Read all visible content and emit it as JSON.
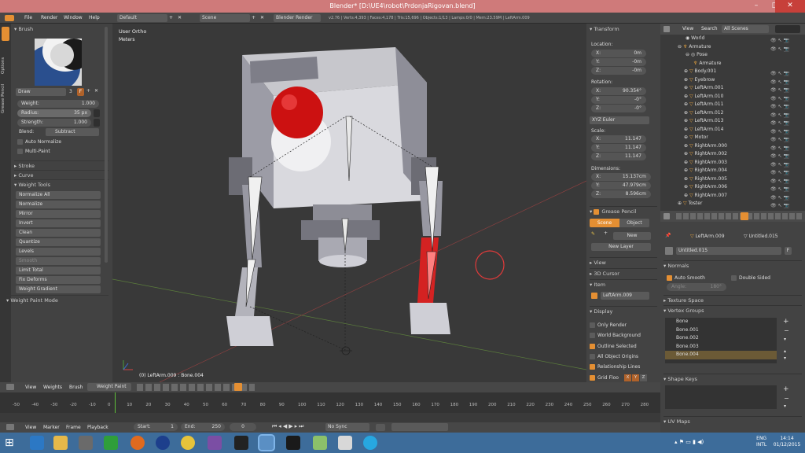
{
  "window": {
    "title": "Blender* [D:\\UE4\\robot\\PrdonjaRigovan.blend]",
    "controls": [
      "–",
      "□",
      "✕"
    ]
  },
  "infobar": {
    "menus": [
      "File",
      "Render",
      "Window",
      "Help"
    ],
    "screen_layout": "Default",
    "scene": "Scene",
    "engine": "Blender Render",
    "stats": "v2.76 | Verts:4,393 | Faces:4,178 | Tris:15,696 | Objects:1/13 | Lamps:0/0 | Mem:23.59M | LeftArm.009"
  },
  "toolshelf": {
    "tabs": [
      "Tools",
      "Options",
      "Grease Pencil"
    ],
    "brush_header": "Brush",
    "brush_name": "Draw",
    "brush_users": "3",
    "brush_fake": "F",
    "weight_label": "Weight:",
    "weight_value": "1.000",
    "radius_label": "Radius:",
    "radius_value": "35 px",
    "strength_label": "Strength:",
    "strength_value": "1.000",
    "blend_label": "Blend:",
    "blend_value": "Subtract",
    "auto_normalize": "Auto Normalize",
    "multi_paint": "Multi-Paint",
    "stroke": "Stroke",
    "curve": "Curve",
    "weight_tools": "Weight Tools",
    "tools": [
      "Normalize All",
      "Normalize",
      "Mirror",
      "Invert",
      "Clean",
      "Quantize",
      "Levels",
      "Smooth",
      "Limit Total",
      "Fix Deforms",
      "Weight Gradient"
    ],
    "mode_panel": "Weight Paint Mode"
  },
  "viewport": {
    "view_name": "User Ortho",
    "units": "Meters",
    "object_info": "(0) LeftArm.009 : Bone.004"
  },
  "npanel": {
    "transform": "Transform",
    "location": "Location:",
    "loc": [
      {
        "axis": "X:",
        "val": "0m"
      },
      {
        "axis": "Y:",
        "val": "-0m"
      },
      {
        "axis": "Z:",
        "val": "-0m"
      }
    ],
    "rotation": "Rotation:",
    "rot": [
      {
        "axis": "X:",
        "val": "90.354°"
      },
      {
        "axis": "Y:",
        "val": "-0°"
      },
      {
        "axis": "Z:",
        "val": "-0°"
      }
    ],
    "rot_mode": "XYZ Euler",
    "scale": "Scale:",
    "scl": [
      {
        "axis": "X:",
        "val": "11.147"
      },
      {
        "axis": "Y:",
        "val": "11.147"
      },
      {
        "axis": "Z:",
        "val": "11.147"
      }
    ],
    "dimensions": "Dimensions:",
    "dim": [
      {
        "axis": "X:",
        "val": "15.137cm"
      },
      {
        "axis": "Y:",
        "val": "47.979cm"
      },
      {
        "axis": "Z:",
        "val": "8.596cm"
      }
    ],
    "grease_pencil": "Grease Pencil",
    "gp_scene": "Scene",
    "gp_object": "Object",
    "gp_new": "New",
    "gp_new_layer": "New Layer",
    "view": "View",
    "cursor": "3D Cursor",
    "item": "Item",
    "item_name": "LeftArm.009",
    "display": "Display",
    "only_render": "Only Render",
    "world_background": "World Background",
    "outline_selected": "Outline Selected",
    "all_object_origins": "All Object Origins",
    "relationship_lines": "Relationship Lines",
    "grid_floor": "Grid Floo",
    "grid_axes": [
      "X",
      "Y",
      "Z"
    ]
  },
  "outliner": {
    "view": "View",
    "search": "Search",
    "filter": "All Scenes",
    "items": [
      "World",
      "Armature",
      "Pose",
      "Armature",
      "Body.001",
      "Eyebrow",
      "LeftArm.001",
      "LeftArm.010",
      "LeftArm.011",
      "LeftArm.012",
      "LeftArm.013",
      "LeftArm.014",
      "Motor",
      "RightArm.000",
      "RightArm.002",
      "RightArm.003",
      "RightArm.004",
      "RightArm.005",
      "RightArm.006",
      "RightArm.007",
      "Toster"
    ]
  },
  "properties": {
    "object_name": "LeftArm.009",
    "mesh_name": "Untitled.015",
    "data_field": "Untitled.015",
    "data_fake": "F",
    "normals": "Normals",
    "auto_smooth": "Auto Smooth",
    "double_sided": "Double Sided",
    "angle_label": "Angle:",
    "angle_value": "180°",
    "texture_space": "Texture Space",
    "vertex_groups": "Vertex Groups",
    "groups": [
      "Bone",
      "Bone.001",
      "Bone.002",
      "Bone.003",
      "Bone.004"
    ],
    "shape_keys": "Shape Keys",
    "uv_maps": "UV Maps"
  },
  "timeline_header": {
    "menus": [
      "View",
      "Weights",
      "Brush"
    ],
    "mode": "Weight Paint"
  },
  "timeline": {
    "ticks": [
      "-50",
      "-40",
      "-30",
      "-20",
      "-10",
      "0",
      "10",
      "20",
      "30",
      "40",
      "50",
      "60",
      "70",
      "80",
      "90",
      "100",
      "110",
      "120",
      "130",
      "140",
      "150",
      "160",
      "170",
      "180",
      "190",
      "200",
      "210",
      "220",
      "230",
      "240",
      "250",
      "260",
      "270",
      "280"
    ],
    "menus": [
      "View",
      "Marker",
      "Frame",
      "Playback"
    ],
    "start_label": "Start:",
    "start_value": "1",
    "end_label": "End:",
    "end_value": "250",
    "current_frame": "0",
    "sync": "No Sync"
  },
  "taskbar": {
    "lang": "ENG",
    "kbd": "INTL",
    "time": "14:14",
    "date": "01/12/2015"
  },
  "colors": {
    "titlebar": "#cf7a7a",
    "accent_orange": "#e48f33",
    "selected_red": "#d32020",
    "taskbar": "#3d6c9a"
  }
}
